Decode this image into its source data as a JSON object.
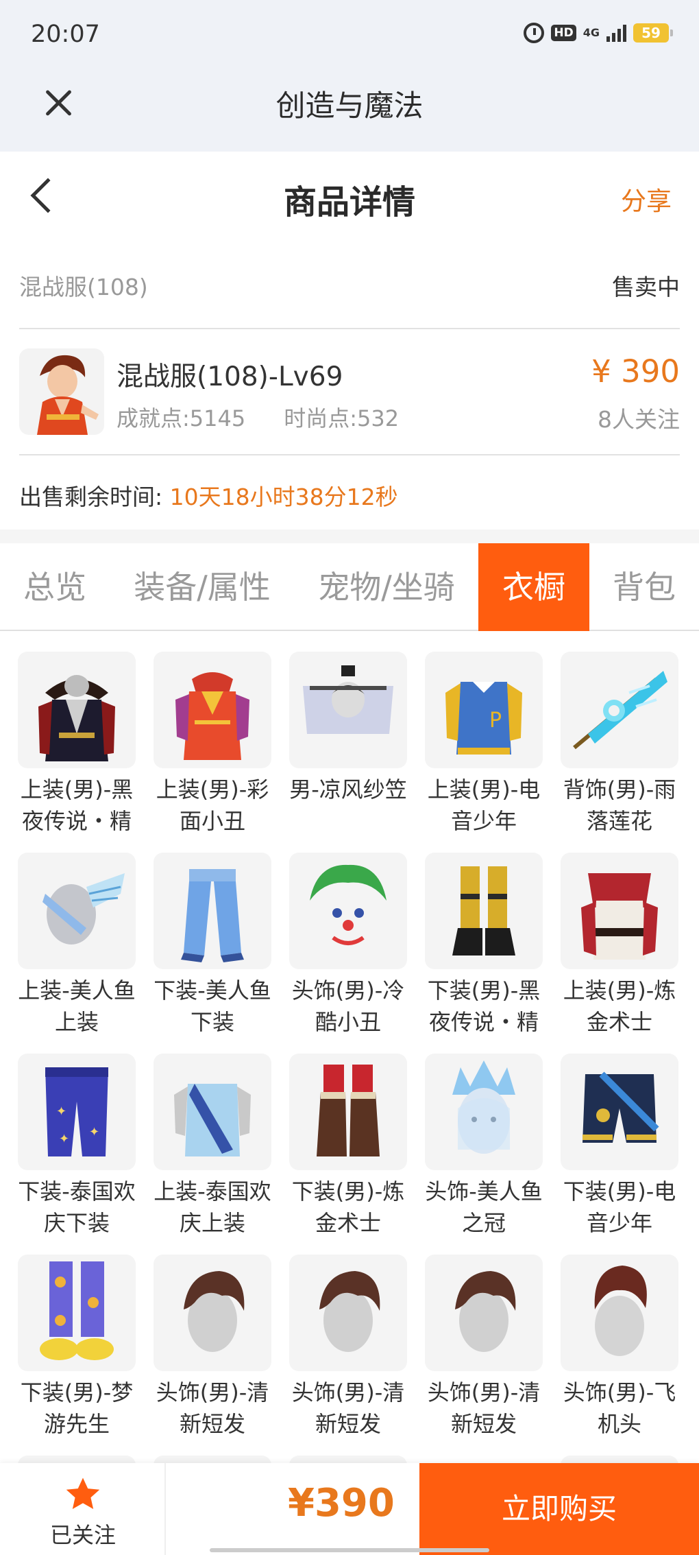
{
  "status_bar": {
    "time": "20:07",
    "hd": "HD",
    "network": "4G",
    "battery": "59"
  },
  "app_bar": {
    "title": "创造与魔法"
  },
  "header": {
    "title": "商品详情",
    "share": "分享"
  },
  "server": {
    "name": "混战服(108)",
    "status": "售卖中"
  },
  "character": {
    "name": "混战服(108)-Lv69",
    "achievement": "成就点:5145",
    "fashion": "时尚点:532",
    "price": "¥ 390",
    "followers": "8人关注"
  },
  "remaining": {
    "label": "出售剩余时间:",
    "value": "10天18小时38分12秒"
  },
  "tabs": [
    "总览",
    "装备/属性",
    "宠物/坐骑",
    "衣橱",
    "背包"
  ],
  "active_tab": "衣橱",
  "wardrobe": [
    {
      "label": "上装(男)-黑夜传说・精",
      "icon": "black-night-top"
    },
    {
      "label": "上装(男)-彩面小丑",
      "icon": "clown-top"
    },
    {
      "label": "男-凉风纱笠",
      "icon": "veil-hat"
    },
    {
      "label": "上装(男)-电音少年",
      "icon": "varsity-jacket"
    },
    {
      "label": "背饰(男)-雨落莲花",
      "icon": "lotus-umbrella"
    },
    {
      "label": "上装-美人鱼上装",
      "icon": "mermaid-top"
    },
    {
      "label": "下装-美人鱼下装",
      "icon": "mermaid-bottom"
    },
    {
      "label": "头饰(男)-冷酷小丑",
      "icon": "clown-mask"
    },
    {
      "label": "下装(男)-黑夜传说・精",
      "icon": "gold-boots"
    },
    {
      "label": "上装(男)-炼金术士",
      "icon": "alchemist-top"
    },
    {
      "label": "下装-泰国欢庆下装",
      "icon": "thai-pants"
    },
    {
      "label": "上装-泰国欢庆上装",
      "icon": "thai-top"
    },
    {
      "label": "下装(男)-炼金术士",
      "icon": "alchemist-boots"
    },
    {
      "label": "头饰-美人鱼之冠",
      "icon": "mermaid-crown"
    },
    {
      "label": "下装(男)-电音少年",
      "icon": "shorts"
    },
    {
      "label": "下装(男)-梦游先生",
      "icon": "pajama-pants"
    },
    {
      "label": "头饰(男)-清新短发",
      "icon": "short-hair"
    },
    {
      "label": "头饰(男)-清新短发",
      "icon": "short-hair"
    },
    {
      "label": "头饰(男)-清新短发",
      "icon": "short-hair"
    },
    {
      "label": "头饰(男)-飞机头",
      "icon": "quiff-hair"
    }
  ],
  "bottom": {
    "follow_label": "已关注",
    "price": "¥390",
    "buy": "立即购买"
  },
  "colors": {
    "accent": "#ff5d0f",
    "price": "#e8781d"
  }
}
